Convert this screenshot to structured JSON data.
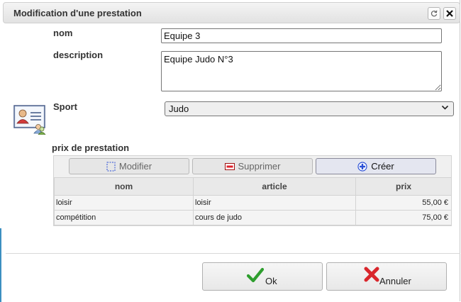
{
  "dialog": {
    "title": "Modification d'une prestation",
    "refresh_icon": "refresh-icon",
    "close_icon": "close-icon"
  },
  "form": {
    "nom_label": "nom",
    "nom_value": "Equipe 3",
    "description_label": "description",
    "description_value": "Equipe Judo N°3",
    "sport_label": "Sport",
    "sport_value": "Judo",
    "sport_icon": "user-card-icon"
  },
  "prices": {
    "section_label": "prix de prestation",
    "toolbar": {
      "modify_label": "Modifier",
      "delete_label": "Supprimer",
      "create_label": "Créer"
    },
    "columns": [
      "nom",
      "article",
      "prix"
    ],
    "rows": [
      {
        "nom": "loisir",
        "article": "loisir",
        "prix": "55,00 €"
      },
      {
        "nom": "compétition",
        "article": "cours de judo",
        "prix": "75,00 €"
      }
    ]
  },
  "footer": {
    "ok_label": "Ok",
    "cancel_label": "Annuler"
  },
  "colors": {
    "check_green": "#2e9e2e",
    "cancel_red": "#d9262c",
    "create_blue": "#2a4fd6",
    "delete_red": "#e0202a"
  }
}
